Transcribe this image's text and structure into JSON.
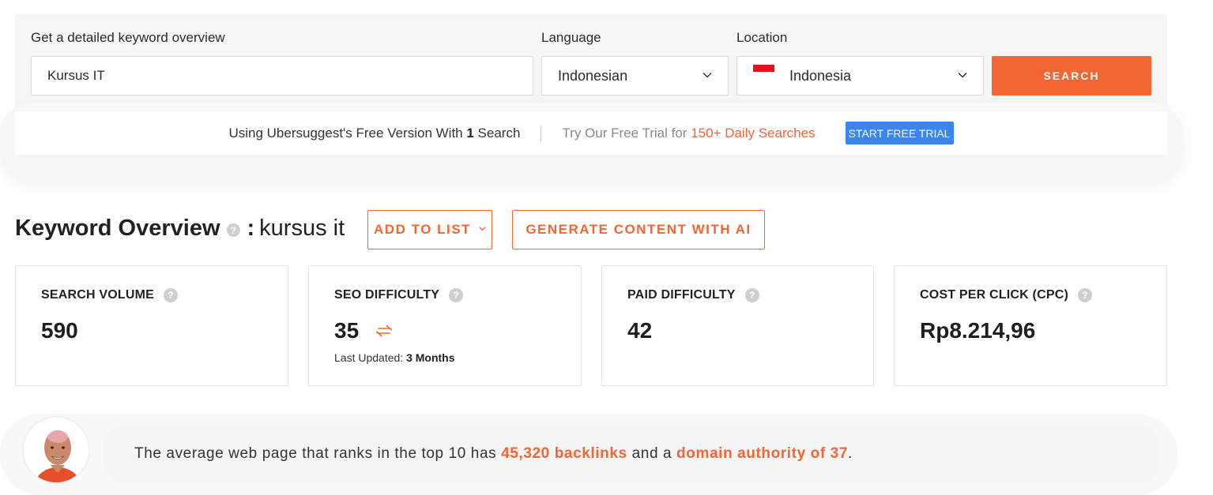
{
  "search": {
    "keyword_label": "Get a detailed keyword overview",
    "keyword_value": "Kursus IT",
    "language_label": "Language",
    "language_value": "Indonesian",
    "location_label": "Location",
    "location_value": "Indonesia",
    "search_button": "SEARCH"
  },
  "free_bar": {
    "text_before": "Using Ubersuggest's Free Version With ",
    "count": "1",
    "text_after": " Search",
    "trial_text": "Try Our Free Trial for ",
    "trial_highlight": "150+ Daily Searches",
    "trial_button": "START FREE TRIAL"
  },
  "overview": {
    "title": "Keyword Overview",
    "colon": ":",
    "keyword": "kursus it",
    "add_to_list": "ADD TO LIST",
    "generate": "GENERATE CONTENT WITH AI"
  },
  "cards": [
    {
      "title": "SEARCH VOLUME",
      "value": "590"
    },
    {
      "title": "SEO DIFFICULTY",
      "value": "35",
      "sub_label": "Last Updated: ",
      "sub_value": "3 Months"
    },
    {
      "title": "PAID DIFFICULTY",
      "value": "42"
    },
    {
      "title": "COST PER CLICK (CPC)",
      "value": "Rp8.214,96"
    }
  ],
  "insight": {
    "text_1": "The average web page that ranks in the top 10 has ",
    "backlinks": "45,320 backlinks",
    "text_2": " and a ",
    "authority": "domain authority of 37",
    "text_3": "."
  },
  "icons": {
    "help": "question-icon",
    "dropdown": "chevron-down-icon",
    "refresh": "refresh-icon",
    "flag": "indonesia-flag-icon"
  },
  "colors": {
    "accent": "#f36633",
    "trial_button": "#3a86f0",
    "panel_bg": "#f5f6f5"
  }
}
